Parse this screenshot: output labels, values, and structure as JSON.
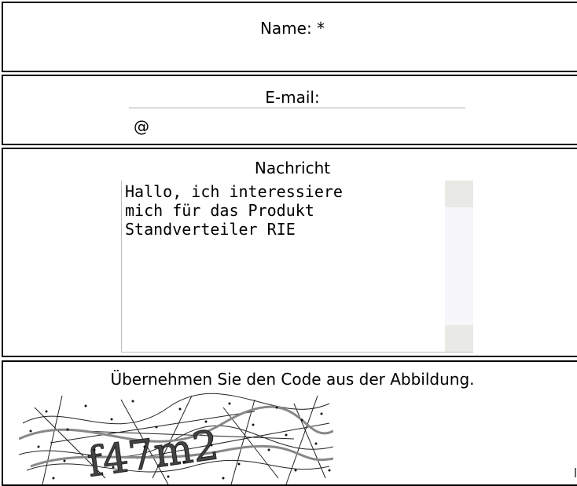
{
  "form": {
    "name_label": "Name: *",
    "name_value": "",
    "email_label": "E-mail:",
    "email_value": "@",
    "message_label": "Nachricht",
    "message_value": "Hallo, ich interessiere\nmich für das Produkt\nStandverteiler RIE",
    "captcha_label": "Übernehmen Sie den Code aus der Abbildung.",
    "captcha_code": "f47m2"
  }
}
